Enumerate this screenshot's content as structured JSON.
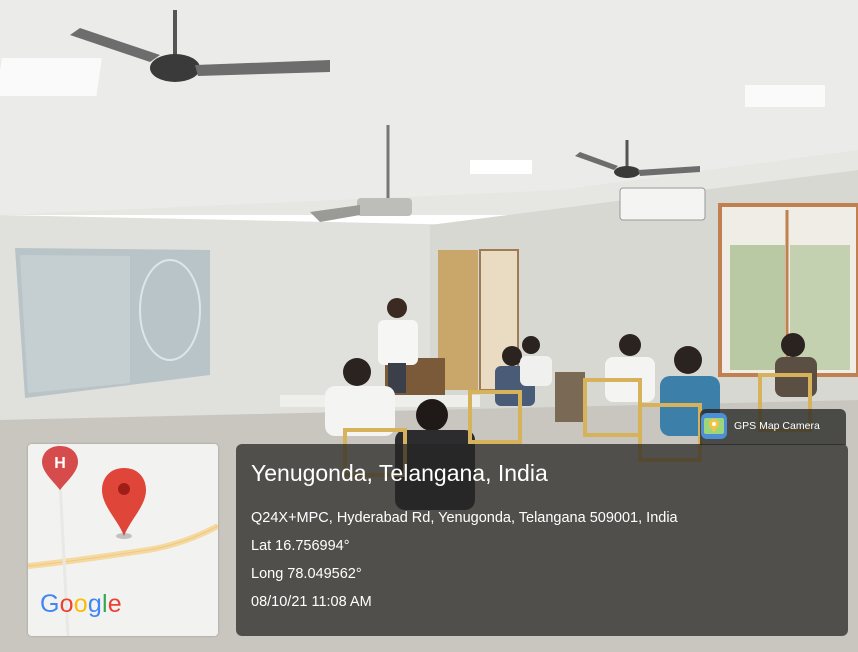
{
  "gps_badge": {
    "label": "GPS Map Camera",
    "icon": "gps-map-camera-icon"
  },
  "location": {
    "title": "Yenugonda, Telangana, India",
    "address": "Q24X+MPC, Hyderabad Rd, Yenugonda, Telangana 509001, India",
    "lat": "Lat 16.756994°",
    "long": "Long 78.049562°",
    "timestamp": "08/10/21 11:08 AM"
  },
  "map": {
    "hospital_marker": "H",
    "pin": "map-pin-icon",
    "logo_letters": [
      {
        "char": "G",
        "color": "#4285F4"
      },
      {
        "char": "o",
        "color": "#EA4335"
      },
      {
        "char": "o",
        "color": "#FBBC05"
      },
      {
        "char": "g",
        "color": "#4285F4"
      },
      {
        "char": "l",
        "color": "#34A853"
      },
      {
        "char": "e",
        "color": "#EA4335"
      }
    ]
  }
}
